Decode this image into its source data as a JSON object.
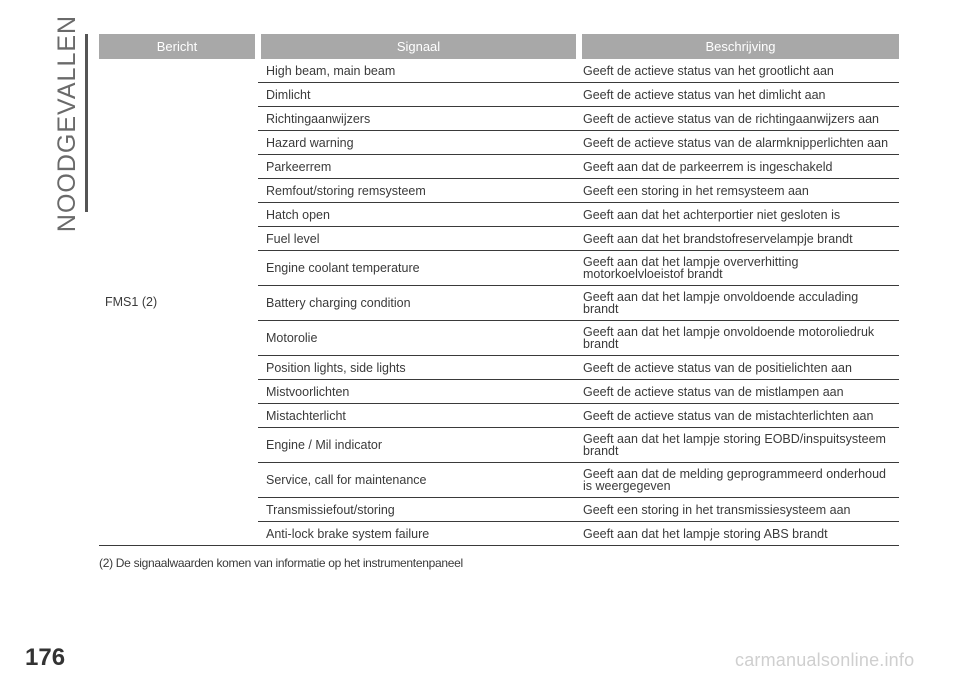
{
  "section_title": "NOODGEVALLEN",
  "table": {
    "headers": [
      "Bericht",
      "Signaal",
      "Beschrijving"
    ],
    "message": "FMS1",
    "message_ref": "(2)",
    "rows": [
      {
        "signal": "High beam, main beam",
        "description": "Geeft de actieve status van het grootlicht aan"
      },
      {
        "signal": "Dimlicht",
        "description": "Geeft de actieve status van het dimlicht aan"
      },
      {
        "signal": "Richtingaanwijzers",
        "description": "Geeft de actieve status van de richtingaanwijzers aan"
      },
      {
        "signal": "Hazard warning",
        "description": "Geeft de actieve status van de alarmknipperlichten aan"
      },
      {
        "signal": "Parkeerrem",
        "description": "Geeft aan dat de parkeerrem is ingeschakeld"
      },
      {
        "signal": "Remfout/storing remsysteem",
        "description": "Geeft een storing in het remsysteem aan"
      },
      {
        "signal": "Hatch open",
        "description": "Geeft aan dat het achterportier niet gesloten is"
      },
      {
        "signal": "Fuel level",
        "description": "Geeft aan dat het brandstofreservelampje brandt"
      },
      {
        "signal": "Engine coolant temperature",
        "description": "Geeft aan dat het lampje oververhitting motorkoelvloeistof brandt"
      },
      {
        "signal": "Battery charging condition",
        "description": "Geeft aan dat het lampje onvoldoende acculading brandt"
      },
      {
        "signal": "Motorolie",
        "description": "Geeft aan dat het lampje onvoldoende motoroliedruk brandt"
      },
      {
        "signal": "Position lights, side lights",
        "description": "Geeft de actieve status van de positielichten aan"
      },
      {
        "signal": "Mistvoorlichten",
        "description": "Geeft de actieve status van de mistlampen aan"
      },
      {
        "signal": "Mistachterlicht",
        "description": "Geeft de actieve status van de mistachterlichten aan"
      },
      {
        "signal": "Engine / Mil indicator",
        "description": "Geeft aan dat het lampje storing EOBD/inspuitsysteem brandt"
      },
      {
        "signal": "Service, call for maintenance",
        "description": "Geeft aan dat de melding geprogrammeerd onderhoud is weergegeven"
      },
      {
        "signal": "Transmissiefout/storing",
        "description": "Geeft een storing in het transmissiesysteem aan"
      },
      {
        "signal": "Anti-lock brake system failure",
        "description": "Geeft aan dat het lampje storing ABS brandt"
      }
    ]
  },
  "footnote": "(2) De signaalwaarden komen van informatie op het instrumentenpaneel",
  "page_number": "176",
  "watermark": "carmanualsonline.info"
}
